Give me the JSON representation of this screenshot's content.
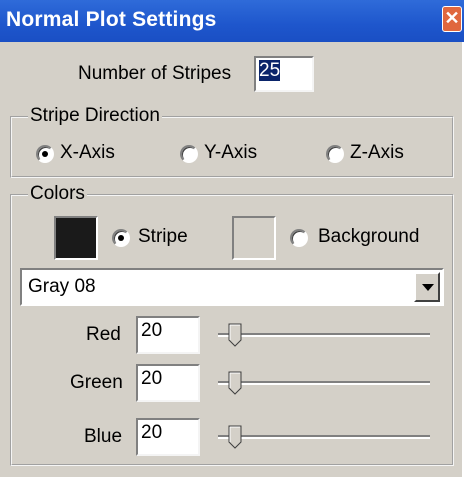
{
  "window": {
    "title": "Normal Plot Settings",
    "close_glyph": "✕"
  },
  "stripes": {
    "label": "Number of Stripes",
    "value": "25"
  },
  "direction": {
    "legend": "Stripe Direction",
    "options": [
      "X-Axis",
      "Y-Axis",
      "Z-Axis"
    ],
    "selected": "X-Axis"
  },
  "colors": {
    "legend": "Colors",
    "stripe_label": "Stripe",
    "background_label": "Background",
    "selected": "Stripe",
    "stripe_color": "#1a1a1a",
    "background_color": "#d4d0c8",
    "preset": "Gray 08",
    "channels": [
      {
        "label": "Red",
        "value": "20",
        "fraction": 0.08
      },
      {
        "label": "Green",
        "value": "20",
        "fraction": 0.08
      },
      {
        "label": "Blue",
        "value": "20",
        "fraction": 0.08
      }
    ]
  }
}
